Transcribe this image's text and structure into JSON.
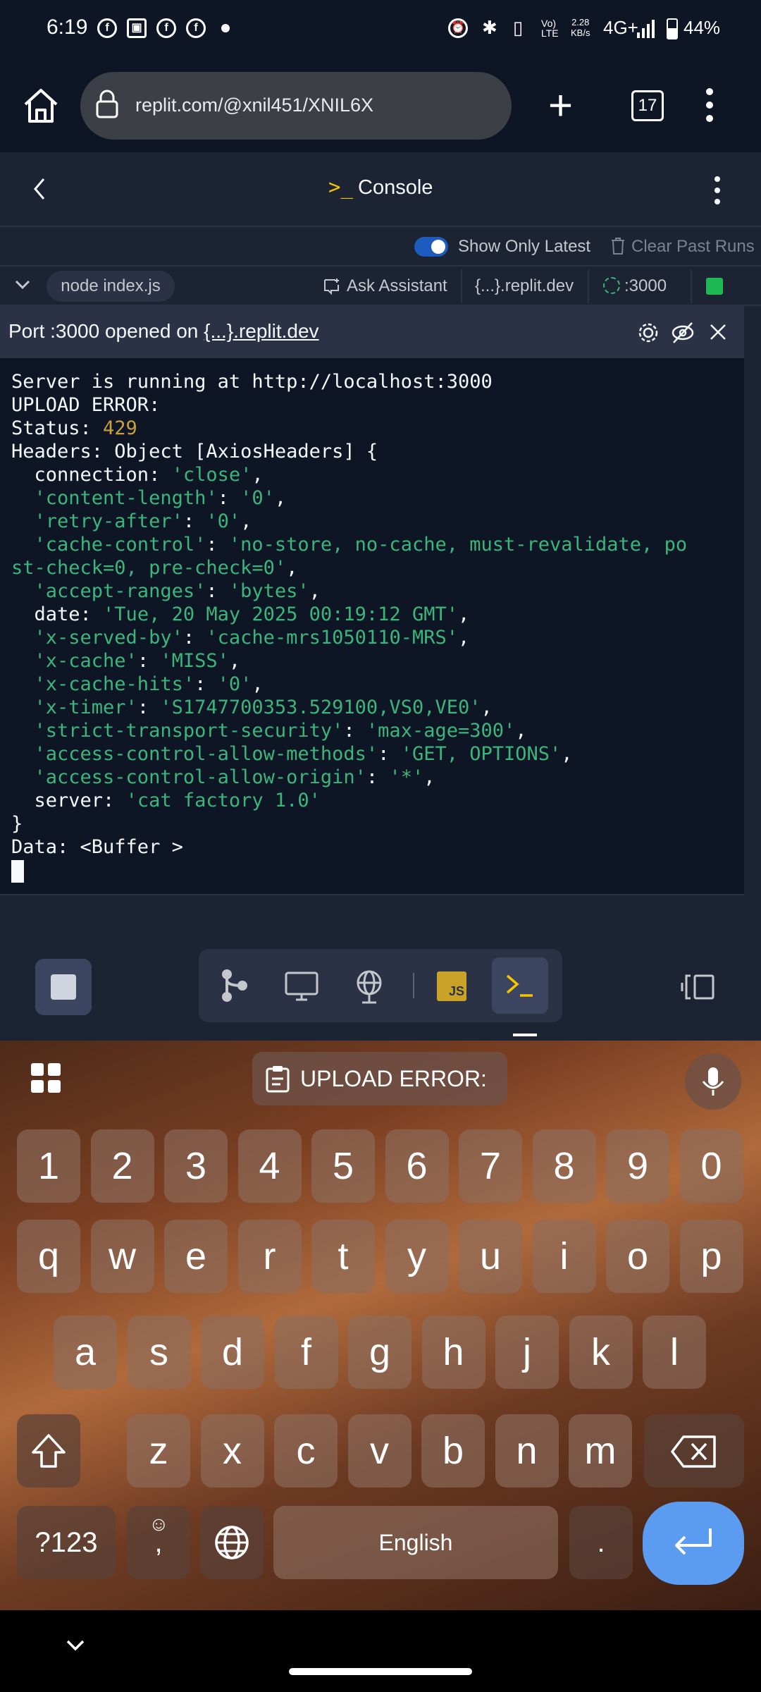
{
  "status_bar": {
    "time": "6:19",
    "speed_top": "2.28",
    "speed_bottom": "KB/s",
    "network": "4G+",
    "battery": "44%"
  },
  "browser": {
    "url": "replit.com/@xnil451/XNIL6X",
    "tab_count": "17"
  },
  "header": {
    "prompt_glyph": ">_",
    "title": "Console"
  },
  "options": {
    "show_latest_label": "Show Only Latest",
    "clear_label": "Clear Past Runs"
  },
  "run_row": {
    "command": "node index.js",
    "ask_label": "Ask Assistant",
    "domain": "{...}.replit.dev",
    "port": ":3000"
  },
  "port_banner": {
    "prefix": "Port :3000 opened on ",
    "link": "{...}.replit.dev"
  },
  "console": {
    "l1": "Server is running at http://localhost:3000",
    "l2": "UPLOAD ERROR:",
    "l3_label": "Status: ",
    "l3_value": "429",
    "l4": "Headers: Object [AxiosHeaders] {",
    "h1_key": "  connection: ",
    "h1_val": "'close'",
    "h2_key": "  'content-length'",
    "h2_val": "'0'",
    "h3_key": "  'retry-after'",
    "h3_val": "'0'",
    "h4_key": "  'cache-control'",
    "h4_val": "'no-store, no-cache, must-revalidate, po",
    "h4_cont": "st-check=0, pre-check=0'",
    "h5_key": "  'accept-ranges'",
    "h5_val": "'bytes'",
    "h6_key": "  date: ",
    "h6_val": "'Tue, 20 May 2025 00:19:12 GMT'",
    "h7_key": "  'x-served-by'",
    "h7_val": "'cache-mrs1050110-MRS'",
    "h8_key": "  'x-cache'",
    "h8_val": "'MISS'",
    "h9_key": "  'x-cache-hits'",
    "h9_val": "'0'",
    "h10_key": "  'x-timer'",
    "h10_val": "'S1747700353.529100,VS0,VE0'",
    "h11_key": "  'strict-transport-security'",
    "h11_val": "'max-age=300'",
    "h12_key": "  'access-control-allow-methods'",
    "h12_val": "'GET, OPTIONS'",
    "h13_key": "  'access-control-allow-origin'",
    "h13_val": "'*'",
    "h14_key": "  server: ",
    "h14_val": "'cat factory 1.0'",
    "close": "}",
    "data_line": "Data: <Buffer >"
  },
  "tools": {
    "js_label": "JS"
  },
  "keyboard": {
    "suggestion": "UPLOAD ERROR:",
    "row_numbers": [
      "1",
      "2",
      "3",
      "4",
      "5",
      "6",
      "7",
      "8",
      "9",
      "0"
    ],
    "row_q": [
      "q",
      "w",
      "e",
      "r",
      "t",
      "y",
      "u",
      "i",
      "o",
      "p"
    ],
    "row_a": [
      "a",
      "s",
      "d",
      "f",
      "g",
      "h",
      "j",
      "k",
      "l"
    ],
    "row_z": [
      "z",
      "x",
      "c",
      "v",
      "b",
      "n",
      "m"
    ],
    "symbols_label": "?123",
    "comma": ",",
    "space_label": "English",
    "period": "."
  },
  "colors": {
    "string": "#3ab67a",
    "number": "#c9a03b",
    "accent_blue": "#1d5bbf",
    "run_green": "#1db954"
  }
}
